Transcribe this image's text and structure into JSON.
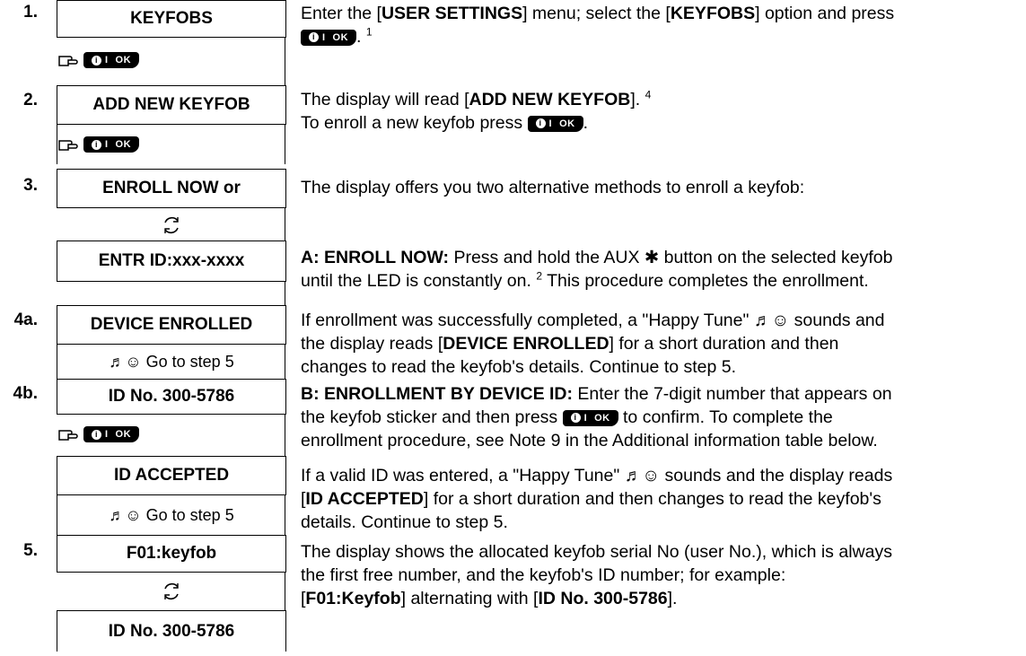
{
  "steps": [
    {
      "num": "1.",
      "box": "KEYFOBS"
    },
    {
      "num": "2.",
      "box": "ADD NEW KEYFOB"
    },
    {
      "num": "3.",
      "box": "ENROLL NOW or",
      "box2": "ENTR ID:xxx-xxxx"
    },
    {
      "num": "4a.",
      "box": "DEVICE ENROLLED",
      "sub": "♬☺ Go to step 5"
    },
    {
      "num": "4b.",
      "box": "ID No. 300-5786",
      "box2": "ID ACCEPTED",
      "sub": "♬☺ Go to step 5"
    },
    {
      "num": "5.",
      "box": "F01:keyfob",
      "box2": "ID No. 300-5786"
    }
  ],
  "key": {
    "icon": "i",
    "label": "OK"
  },
  "desc": {
    "s1a": "Enter the [",
    "s1b": "USER SETTINGS",
    "s1c": "] menu; select the [",
    "s1d": "KEYFOBS",
    "s1e": "] option and press",
    "s1sup": "1",
    "s2a": "The display will read [",
    "s2b": "ADD NEW KEYFOB",
    "s2c": "].",
    "s2sup": "4",
    "s2d": "To enroll a new keyfob press",
    "s3": "The display offers you two alternative methods to enroll a keyfob:",
    "s3b_bold": "A: ENROLL NOW:",
    "s3b_a": " Press and hold the AUX ✱ button on the selected keyfob",
    "s3b_b": "until the LED is constantly on.",
    "s3b_sup": "2",
    "s3b_c": " This procedure completes the enrollment.",
    "s4a_a": "If enrollment was successfully completed, a \"Happy Tune\" ♬☺ sounds and",
    "s4a_b1": "the display reads [",
    "s4a_b2": "DEVICE ENROLLED",
    "s4a_b3": "] for a short duration and then",
    "s4a_c": "changes to read the keyfob's details. Continue to step 5.",
    "s4b_bold": "B: ENROLLMENT BY DEVICE ID:",
    "s4b_a": " Enter the 7-digit number that appears on",
    "s4b_b1": "the keyfob sticker and then press",
    "s4b_b2": "to confirm. To complete the",
    "s4b_c": "enrollment procedure, see Note 9 in the Additional information table below.",
    "s4c_a": "If a valid ID was entered, a \"Happy Tune\" ♬☺ sounds and the display reads",
    "s4c_b1": "[",
    "s4c_b2": "ID ACCEPTED",
    "s4c_b3": "] for a short duration and then changes to read the keyfob's",
    "s4c_c": "details. Continue to step 5.",
    "s5_a": "The display shows the allocated keyfob serial No (user No.), which is always",
    "s5_b": "the first free number, and the keyfob's ID number; for example:",
    "s5_c1": "[",
    "s5_c2": "F01:Keyfob",
    "s5_c3": "] alternating with [",
    "s5_c4": "ID No. 300-5786",
    "s5_c5": "]."
  }
}
